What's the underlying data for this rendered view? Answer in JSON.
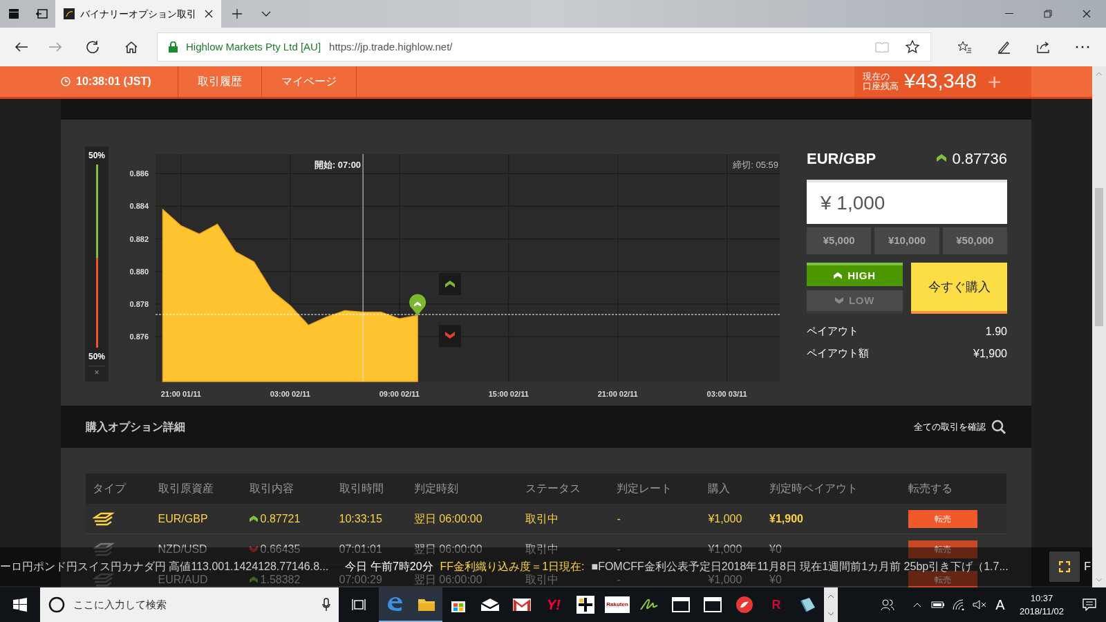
{
  "browser": {
    "tab_title": "バイナリーオプション取引",
    "site_name": "Highlow Markets Pty Ltd [AU]",
    "url": "https://jp.trade.highlow.net/"
  },
  "nav": {
    "clock": "10:38:01 (JST)",
    "items": [
      "取引履歴",
      "マイページ"
    ],
    "balance_label_1": "現在の",
    "balance_label_2": "口座残高",
    "balance": "¥43,348",
    "add": "+"
  },
  "meter": {
    "top_label": "50%",
    "bottom_label": "50%",
    "level": 0.5,
    "close": "×"
  },
  "chart": {
    "start_label": "開始: 07:00",
    "deadline_label": "締切: 05:59",
    "chart_data": {
      "type": "area",
      "categories": [
        null,
        "21:00 01/11",
        null,
        null,
        null,
        null,
        null,
        "03:00 02/11",
        null,
        null,
        null,
        null,
        null,
        "09:00 02/11",
        null,
        null,
        null,
        null,
        null,
        "15:00 02/11",
        null,
        null,
        null,
        null,
        null,
        "21:00 02/11",
        null,
        null,
        null,
        null,
        null,
        "03:00 03/11",
        null,
        null
      ],
      "series": [
        {
          "color": "#ffc531",
          "values": [
            0.8838,
            0.8828,
            0.8823,
            0.8829,
            0.8812,
            0.8806,
            0.8788,
            0.8779,
            0.8767,
            0.8772,
            0.8776,
            0.8775,
            0.8775,
            0.8771,
            0.8773,
            null,
            null,
            null,
            null,
            null,
            null,
            null,
            null,
            null,
            null,
            null,
            null,
            null,
            null,
            null,
            null,
            null,
            null,
            null
          ]
        }
      ],
      "ylim": [
        0.87325,
        0.8872
      ],
      "grid": true,
      "ref_lines": [
        {
          "axis": "y",
          "value": 0.87736
        }
      ],
      "yticks": [
        {
          "value": 0.876,
          "label": "0.876"
        },
        {
          "value": 0.878,
          "label": "0.878"
        },
        {
          "value": 0.88,
          "label": "0.880"
        },
        {
          "value": 0.882,
          "label": "0.882"
        },
        {
          "value": 0.884,
          "label": "0.884"
        },
        {
          "value": 0.886,
          "label": "0.886"
        }
      ]
    }
  },
  "trade": {
    "pair": "EUR/GBP",
    "rate": "0.87736",
    "amount": "¥ 1,000",
    "presets": [
      "¥5,000",
      "¥10,000",
      "¥50,000"
    ],
    "directions": [
      {
        "kind": "high",
        "label": "HIGH",
        "selected": true
      },
      {
        "kind": "low",
        "label": "LOW",
        "selected": false
      }
    ],
    "buy": "今すぐ購入",
    "payout_label": "ペイアウト",
    "payout": "1.90",
    "payout_amount_label": "ペイアウト額",
    "payout_amount": "¥1,900"
  },
  "options": {
    "title": "購入オプション詳細",
    "view_all": "全ての取引を確認",
    "columns": [
      "タイプ",
      "取引原資産",
      "取引内容",
      "取引時間",
      "判定時刻",
      "ステータス",
      "判定レート",
      "購入",
      "判定時ペイアウト",
      "転売する"
    ],
    "rows": [
      {
        "asset": "EUR/GBP",
        "up": true,
        "rate": "0.87721",
        "time": "10:33:15",
        "expiry": "翌日 06:00:00",
        "status": "取引中",
        "result_rate": "-",
        "purchase": "¥1,000",
        "payout": "¥1,900",
        "resell": "転売",
        "highlight": true
      },
      {
        "asset": "NZD/USD",
        "up": false,
        "rate": "0.66435",
        "time": "07:01:01",
        "expiry": "翌日 06:00:00",
        "status": "取引中",
        "result_rate": "-",
        "purchase": "¥1,000",
        "payout": "¥0",
        "resell": "転売",
        "highlight": false
      },
      {
        "asset": "EUR/AUD",
        "up": true,
        "rate": "1.58382",
        "time": "07:00:29",
        "expiry": "翌日 06:00:00",
        "status": "取引中",
        "result_rate": "-",
        "purchase": "¥1,000",
        "payout": "¥0",
        "resell": "転売",
        "highlight": false
      }
    ]
  },
  "ticker": {
    "items": [
      {
        "kind": "plain",
        "text": "ーロ円ポンド円スイス円カナダ円 高値113.001.1424128.77146.8..."
      },
      {
        "kind": "time",
        "text": "今日 午前7時20分"
      },
      {
        "kind": "headline",
        "text": "FF金利織り込み度＝1日現在:"
      },
      {
        "kind": "plain",
        "text": "■FOMCFF金利公表予定日2018年11月8日 現在1週間前1カ月前 25bp引き下げ（1.7..."
      }
    ],
    "edge_text": "F"
  },
  "taskbar": {
    "search_placeholder": "ここに入力して検索",
    "apps": [
      {
        "kind": "edge",
        "active": true
      },
      {
        "kind": "folder",
        "active": true
      },
      {
        "kind": "store",
        "active": false
      },
      {
        "kind": "mail",
        "active": false
      },
      {
        "kind": "gmail",
        "active": false
      },
      {
        "kind": "text",
        "label": "Y!",
        "color": "#ff0033",
        "active": false
      },
      {
        "kind": "cross",
        "active": false
      },
      {
        "kind": "text",
        "label": "Rakuten",
        "color": "#bf0000",
        "active": false
      },
      {
        "kind": "script",
        "active": false
      },
      {
        "kind": "window",
        "active": false
      },
      {
        "kind": "window",
        "active": false
      },
      {
        "kind": "chat",
        "active": false
      },
      {
        "kind": "text",
        "label": "R",
        "color": "#c8102e",
        "active": false
      },
      {
        "kind": "book",
        "active": false
      }
    ],
    "ime": "A",
    "time": "10:37",
    "date": "2018/11/02"
  }
}
